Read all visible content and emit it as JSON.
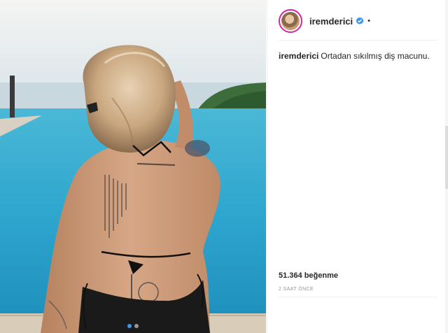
{
  "post": {
    "username": "iremderici",
    "caption_username": "iremderici",
    "caption_text": "Ortadan sıkılmış diş macunu.",
    "likes": "51.364 beğenme",
    "timestamp": "2 SAAT ÖNCE"
  },
  "media": {
    "image_count": 2,
    "active_index": 0,
    "scene": "woman-back-pool-photo"
  },
  "colors": {
    "accent_blue": "#3897f0",
    "text": "#262626",
    "muted": "#999999",
    "divider": "#efefef",
    "avatar_ring": "#d6249f"
  },
  "icons": [
    "verified-icon",
    "more-options-icon"
  ]
}
